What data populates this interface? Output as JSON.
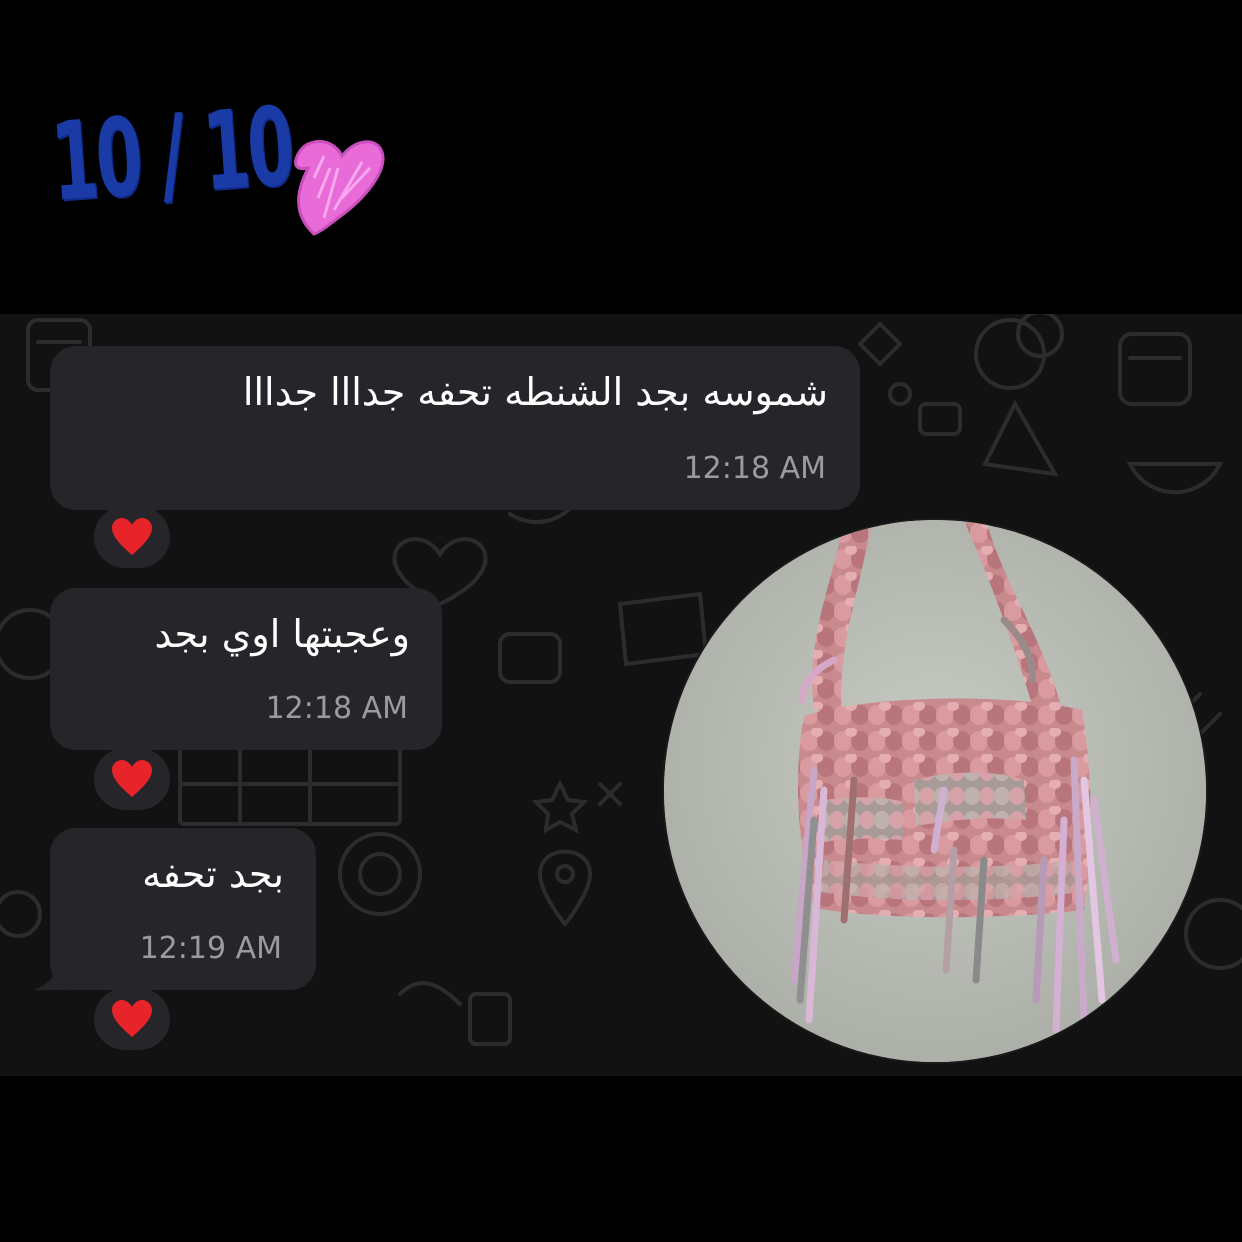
{
  "rating": {
    "text": "10 / 10",
    "heart_icon": "pink-heart-doodle-icon",
    "text_color": "#1a3aa6",
    "heart_color": "#e86bd8"
  },
  "chat": {
    "background_color": "#121212",
    "bubble_color": "#26262a",
    "messages": [
      {
        "text": "شموسه بجد الشنطه تحفه جدااا جدااا",
        "time": "12:18 AM",
        "reaction": "❤️"
      },
      {
        "text": "وعجبتها اوي بجد",
        "time": "12:18 AM",
        "reaction": "❤️"
      },
      {
        "text": "بجد تحفه",
        "time": "12:19 AM",
        "reaction": "❤️"
      }
    ],
    "attachment": {
      "icon": "crochet-bag-photo"
    }
  }
}
